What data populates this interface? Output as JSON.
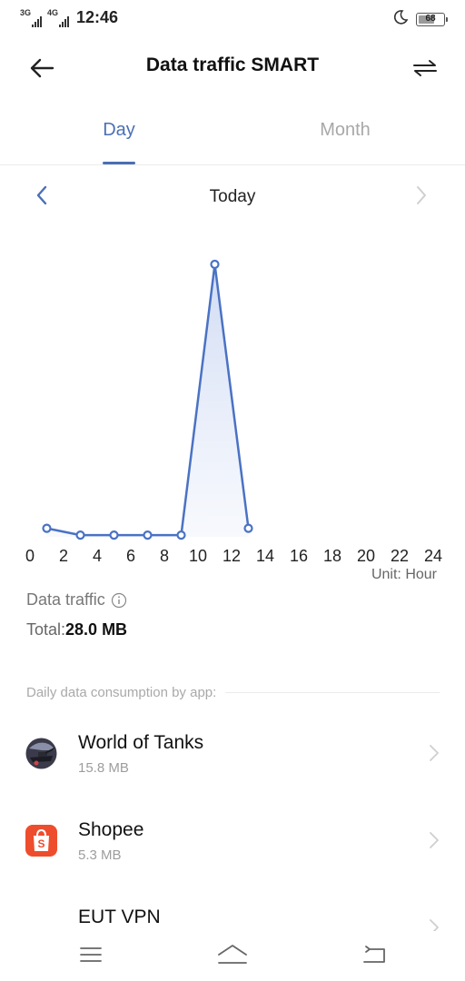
{
  "status_bar": {
    "network_1": "3G",
    "network_2": "4G",
    "time": "12:46",
    "battery": 68,
    "battery_label": "68",
    "icons": [
      "signal-icon",
      "moon-icon",
      "battery-icon"
    ]
  },
  "header": {
    "title": "Data traffic SMART",
    "icons": [
      "back-arrow-icon",
      "switch-sim-icon"
    ]
  },
  "tabs": {
    "day": "Day",
    "month": "Month",
    "active": "day"
  },
  "period": {
    "label": "Today",
    "icons": [
      "chevron-left-icon",
      "chevron-right-icon"
    ]
  },
  "colors": {
    "accent": "#4a6fb5",
    "line": "#4a72c4",
    "inactive": "#a8a8a8"
  },
  "chart_data": {
    "type": "area",
    "x_ticks": [
      "0",
      "2",
      "4",
      "6",
      "8",
      "10",
      "12",
      "14",
      "16",
      "18",
      "20",
      "22",
      "24"
    ],
    "x": [
      1,
      3,
      5,
      7,
      9,
      11,
      13
    ],
    "values": [
      0.5,
      0.1,
      0.1,
      0.1,
      0.1,
      16.0,
      0.5
    ],
    "xlim": [
      0,
      24
    ],
    "ylim": [
      0,
      16.0
    ],
    "unit_label": "Unit: Hour",
    "grid": false
  },
  "traffic": {
    "label": "Data traffic",
    "total_prefix": "Total:",
    "total_value": "28.0 MB"
  },
  "section": {
    "title": "Daily data consumption by app:"
  },
  "apps": [
    {
      "name": "World of Tanks",
      "size": "15.8 MB",
      "icon": "world-of-tanks-icon"
    },
    {
      "name": "Shopee",
      "size": "5.3 MB",
      "icon": "shopee-icon"
    },
    {
      "name": "EUT VPN",
      "size": "",
      "icon": "eut-vpn-icon"
    }
  ],
  "nav": {
    "icons": [
      "menu-icon",
      "home-icon",
      "back-icon"
    ]
  }
}
